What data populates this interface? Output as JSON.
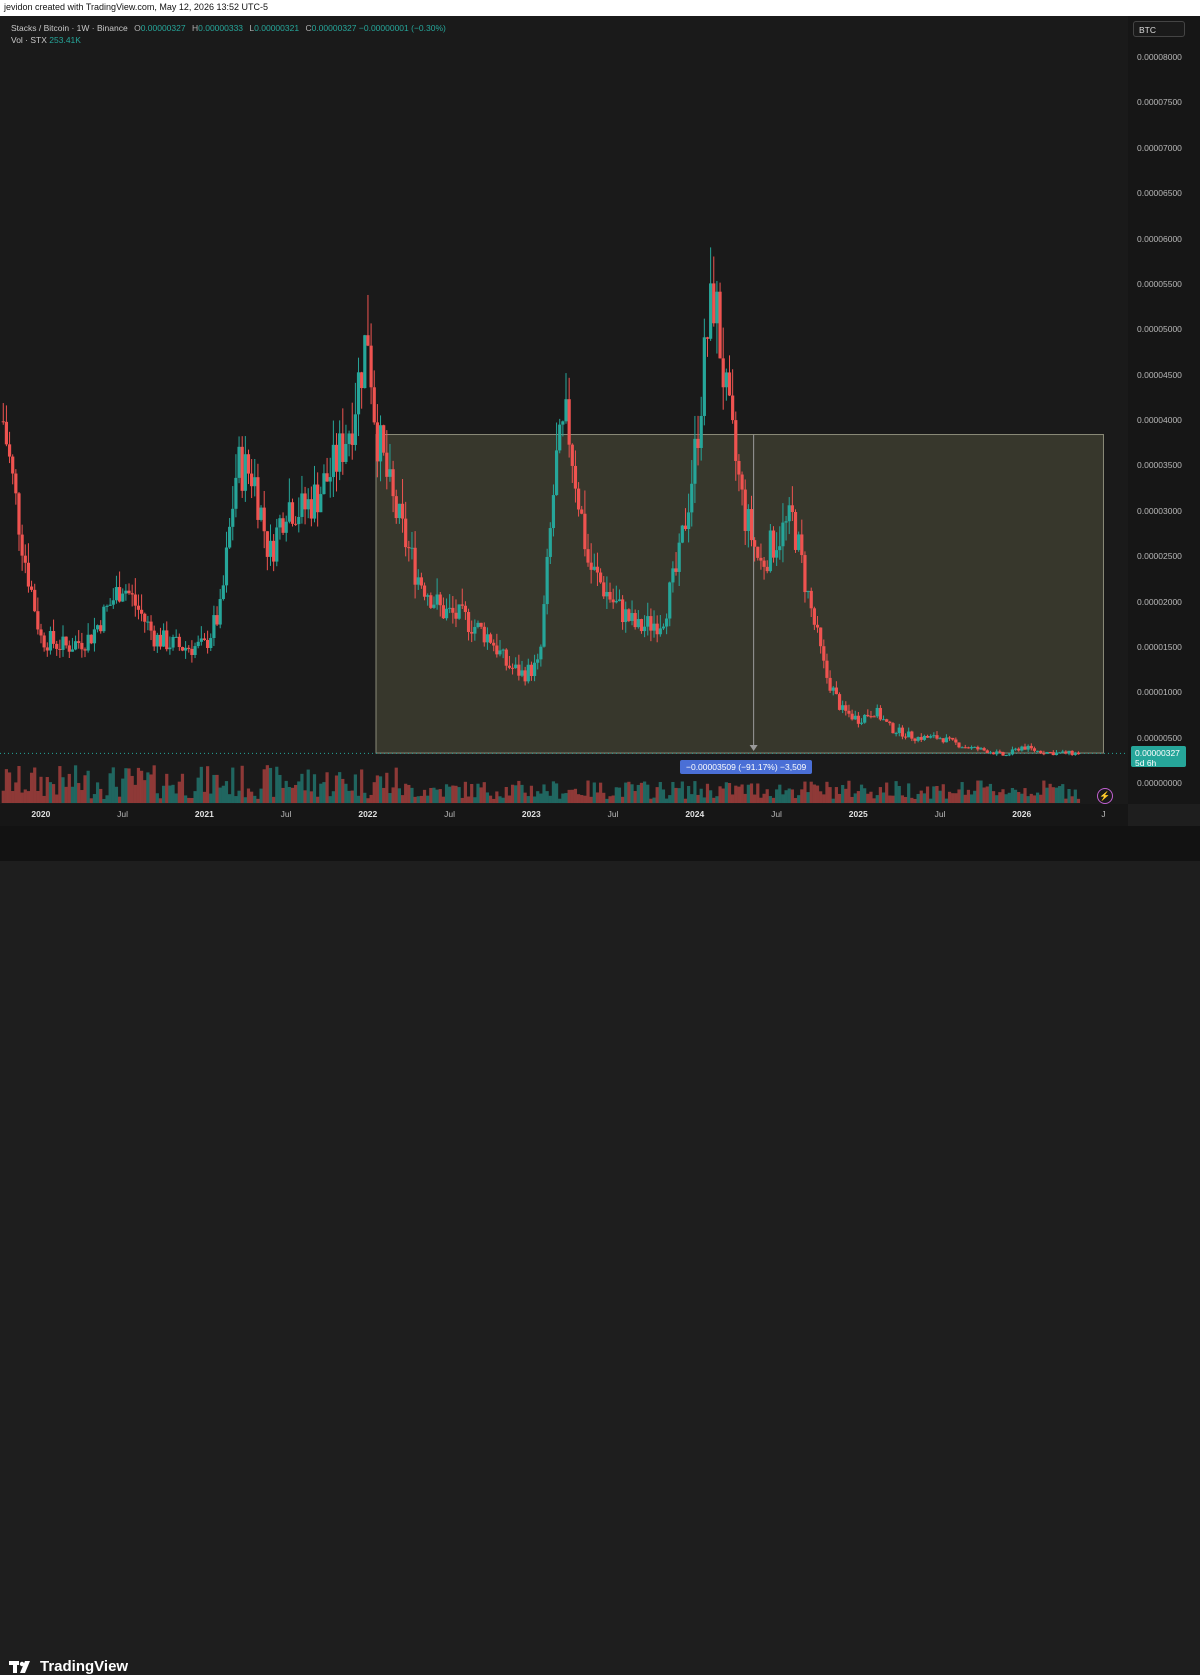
{
  "header": {
    "credit": "jevidon created with TradingView.com, May 12, 2026 13:52 UTC-5"
  },
  "legend": {
    "symbol": "Stacks / Bitcoin · 1W · Binance",
    "o_label": "O",
    "o": "0.00000327",
    "h_label": "H",
    "h": "0.00000333",
    "l_label": "L",
    "l": "0.00000321",
    "c_label": "C",
    "c": "0.00000327",
    "change": "−0.00000001 (−0.30%)",
    "vol_label": "Vol · STX",
    "vol": "253.41K"
  },
  "currency_badge": "BTC",
  "last_price": {
    "value": "0.00000327",
    "countdown": "5d 6h"
  },
  "measure": {
    "text": "−0.00003509 (−91.17%) −3,509"
  },
  "footer": {
    "brand": "TradingView"
  },
  "colors": {
    "up": "#26a69a",
    "down": "#ef5350",
    "box": "#3d3d30",
    "measure": "#4a6fd6"
  },
  "chart_data": {
    "type": "candlestick",
    "title": "Stacks / Bitcoin · 1W · Binance",
    "price_ticks": [
      "0.00008000",
      "0.00007500",
      "0.00007000",
      "0.00006500",
      "0.00006000",
      "0.00005500",
      "0.00005000",
      "0.00004500",
      "0.00004000",
      "0.00003500",
      "0.00003000",
      "0.00002500",
      "0.00002000",
      "0.00001500",
      "0.00001000",
      "0.00000500",
      "0.00000000"
    ],
    "ylim": [
      0,
      8e-05
    ],
    "time_ticks": [
      "2020",
      "Jul",
      "2021",
      "Jul",
      "2022",
      "Jul",
      "2023",
      "Jul",
      "2024",
      "Jul",
      "2025",
      "Jul",
      "2026",
      "J"
    ],
    "xlim": [
      2019.75,
      2026.65
    ],
    "x": [
      2019.76,
      2019.9,
      2020.0,
      2020.15,
      2020.3,
      2020.5,
      2020.7,
      2020.85,
      2021.0,
      2021.1,
      2021.2,
      2021.3,
      2021.4,
      2021.5,
      2021.6,
      2021.7,
      2021.8,
      2021.9,
      2022.0,
      2022.05,
      2022.15,
      2022.3,
      2022.45,
      2022.6,
      2022.75,
      2022.85,
      2022.95,
      2023.05,
      2023.15,
      2023.22,
      2023.35,
      2023.5,
      2023.65,
      2023.8,
      2023.9,
      2024.0,
      2024.08,
      2024.12,
      2024.2,
      2024.3,
      2024.4,
      2024.5,
      2024.6,
      2024.7,
      2024.8,
      2024.9,
      2025.0,
      2025.1,
      2025.2,
      2025.35,
      2025.5,
      2025.65,
      2025.8,
      2025.9,
      2026.0,
      2026.1,
      2026.2,
      2026.36
    ],
    "close": [
      4.1e-05,
      2.5e-05,
      1.6e-05,
      1.5e-05,
      1.6e-05,
      2.2e-05,
      1.6e-05,
      1.5e-05,
      1.5e-05,
      1.9e-05,
      3.5e-05,
      3.4e-05,
      2.5e-05,
      3.1e-05,
      3e-05,
      3.2e-05,
      3.5e-05,
      4e-05,
      5e-05,
      3.9e-05,
      3.1e-05,
      2.3e-05,
      1.9e-05,
      1.8e-05,
      1.6e-05,
      1.3e-05,
      1.2e-05,
      1.3e-05,
      3.5e-05,
      4e-05,
      2.4e-05,
      2e-05,
      1.7e-05,
      1.8e-05,
      2.4e-05,
      3.6e-05,
      5e-05,
      5.4e-05,
      4.1e-05,
      3e-05,
      2.4e-05,
      2.7e-05,
      2.9e-05,
      2e-05,
      1.2e-05,
      8e-06,
      7e-06,
      8e-06,
      6e-06,
      5e-06,
      5e-06,
      4e-06,
      3.5e-06,
      3e-06,
      4e-06,
      3.5e-06,
      3.3e-06,
      3.27e-06
    ],
    "volume_note": "volume histogram",
    "measure_range": {
      "from": 3.84e-05,
      "to": 3.3e-06,
      "x_from": 2022.05,
      "x_to": 2026.5
    },
    "last_value": 3.27e-06
  }
}
